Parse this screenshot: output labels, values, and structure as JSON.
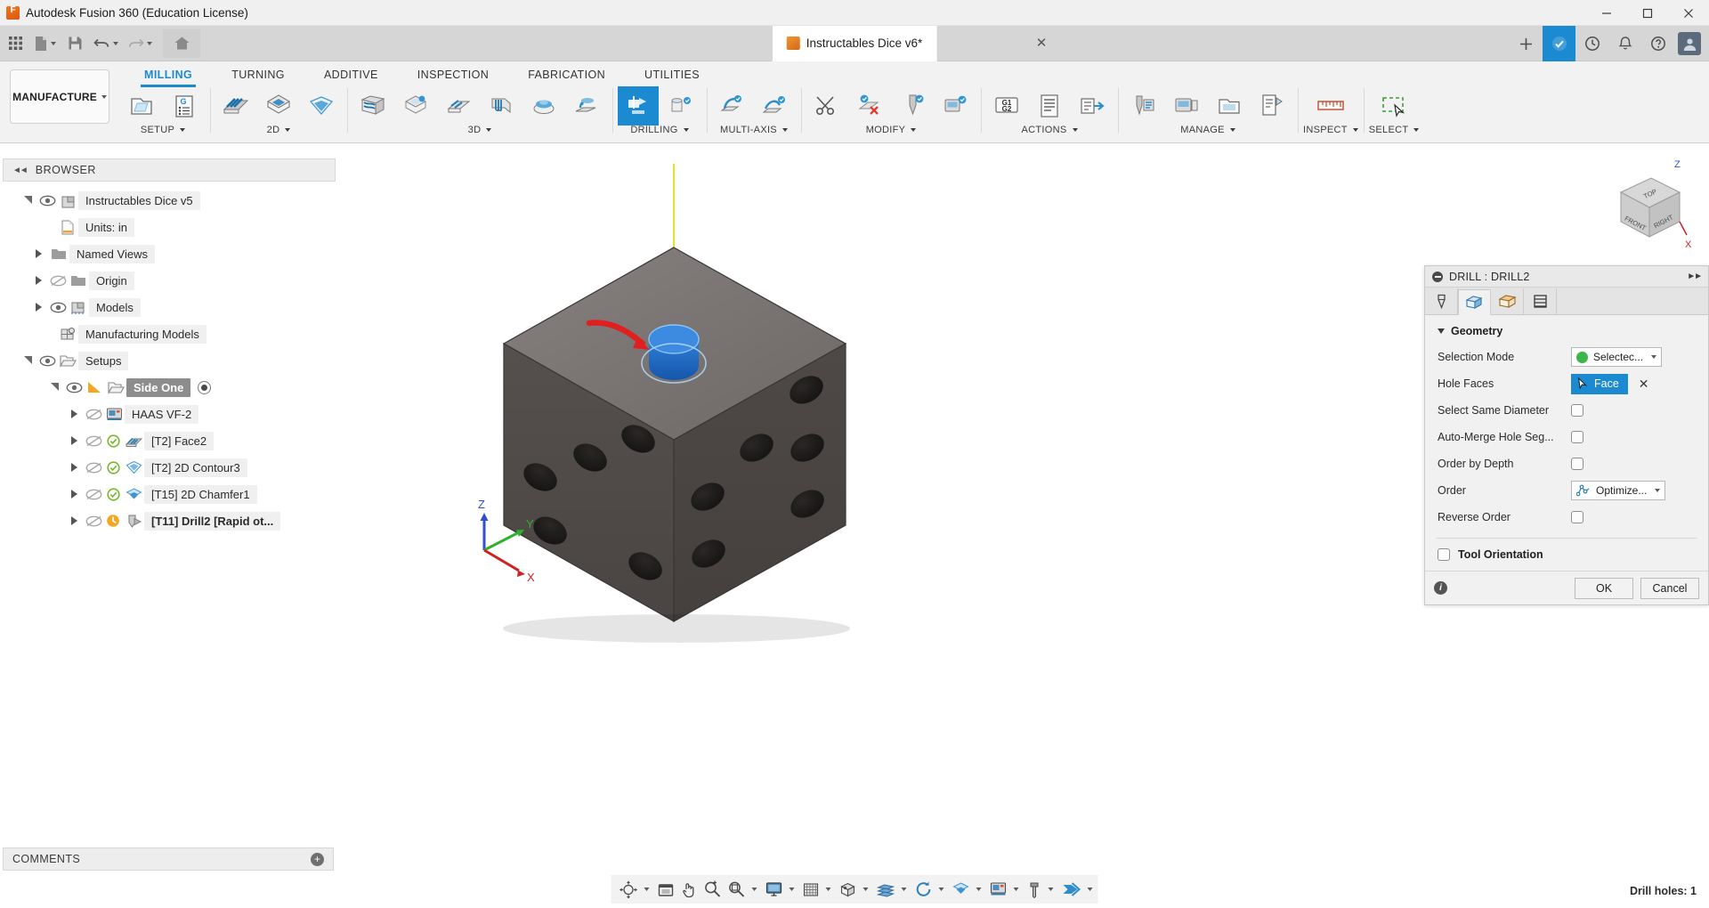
{
  "window": {
    "title": "Autodesk Fusion 360 (Education License)",
    "logo_icon": "fusion-360-logo",
    "minimize_icon": "minimize-icon",
    "maximize_icon": "maximize-icon",
    "close_icon": "close-icon"
  },
  "quick_access": {
    "grid_icon": "app-grid-icon",
    "new_icon": "new-document-icon",
    "save_icon": "save-icon",
    "undo_icon": "undo-icon",
    "redo_icon": "redo-icon",
    "home_icon": "home-icon",
    "document_tab": {
      "name": "Instructables Dice v6*",
      "file_icon": "orange-cube-icon",
      "close_icon": "close-tab-icon"
    },
    "add_tab_icon": "plus-icon",
    "extension_icon": "extension-icon",
    "history_icon": "job-status-icon",
    "notifications_icon": "bell-icon",
    "help_icon": "help-icon",
    "avatar_icon": "user-avatar"
  },
  "ribbon": {
    "workspace": {
      "label": "MANUFACTURE",
      "caret": "chevron-down-icon"
    },
    "tabs": [
      {
        "label": "MILLING",
        "active": true
      },
      {
        "label": "TURNING",
        "active": false
      },
      {
        "label": "ADDITIVE",
        "active": false
      },
      {
        "label": "INSPECTION",
        "active": false
      },
      {
        "label": "FABRICATION",
        "active": false
      },
      {
        "label": "UTILITIES",
        "active": false
      }
    ],
    "panels": [
      {
        "label": "SETUP",
        "has_caret": true,
        "buttons": [
          {
            "icon": "setup-new-icon",
            "selected": false
          },
          {
            "icon": "generate-nc-program-icon",
            "selected": false
          }
        ]
      },
      {
        "label": "2D",
        "has_caret": true,
        "buttons": [
          {
            "icon": "face-2d-icon",
            "selected": false
          },
          {
            "icon": "pocket-2d-icon",
            "selected": false
          },
          {
            "icon": "contour-2d-icon",
            "selected": false
          }
        ]
      },
      {
        "label": "3D",
        "has_caret": true,
        "buttons": [
          {
            "icon": "adaptive-clearing-icon",
            "selected": false
          },
          {
            "icon": "pocket-clearing-icon",
            "selected": false
          },
          {
            "icon": "parallel-3d-icon",
            "selected": false
          },
          {
            "icon": "scallop-3d-icon",
            "selected": false
          },
          {
            "icon": "radial-3d-icon",
            "selected": false
          },
          {
            "icon": "spiral-3d-icon",
            "selected": false
          }
        ]
      },
      {
        "label": "DRILLING",
        "has_caret": true,
        "buttons": [
          {
            "icon": "drill-icon",
            "selected": true
          },
          {
            "icon": "bore-icon",
            "selected": false
          }
        ]
      },
      {
        "label": "MULTI-AXIS",
        "has_caret": true,
        "buttons": [
          {
            "icon": "swarf-icon",
            "selected": false
          },
          {
            "icon": "multi-axis-contour-icon",
            "selected": false
          }
        ]
      },
      {
        "label": "MODIFY",
        "has_caret": true,
        "buttons": [
          {
            "icon": "trim-icon",
            "selected": false
          },
          {
            "icon": "delete-toolpath-icon",
            "selected": false
          },
          {
            "icon": "tool-library-icon",
            "selected": false
          },
          {
            "icon": "machine-library-icon",
            "selected": false
          }
        ]
      },
      {
        "label": "ACTIONS",
        "has_caret": true,
        "buttons": [
          {
            "icon": "g1-g2-icon",
            "selected": false
          },
          {
            "icon": "setup-sheet-icon",
            "selected": false
          },
          {
            "icon": "post-process-icon",
            "selected": false
          }
        ]
      },
      {
        "label": "MANAGE",
        "has_caret": true,
        "buttons": [
          {
            "icon": "tool-library-manage-icon",
            "selected": false
          },
          {
            "icon": "machine-library-manage-icon",
            "selected": false
          },
          {
            "icon": "template-library-icon",
            "selected": false
          },
          {
            "icon": "print-setup-icon",
            "selected": false
          }
        ]
      },
      {
        "label": "INSPECT",
        "has_caret": true,
        "buttons": [
          {
            "icon": "measure-icon",
            "selected": false
          }
        ]
      },
      {
        "label": "SELECT",
        "has_caret": true,
        "buttons": [
          {
            "icon": "select-window-icon",
            "selected": false
          }
        ]
      }
    ]
  },
  "browser": {
    "header": "BROWSER",
    "collapse_icon": "collapse-left-icon",
    "tree": [
      {
        "label": "Instructables Dice v5",
        "indent": 0,
        "expander": "down",
        "eye": "visible",
        "icon": "document-body-icon",
        "selected": false
      },
      {
        "label": "Units: in",
        "indent": 1,
        "expander": "none",
        "eye": "none",
        "icon": "units-icon",
        "selected": false
      },
      {
        "label": "Named Views",
        "indent": 1,
        "expander": "right",
        "eye": "none",
        "icon": "folder-icon",
        "selected": false
      },
      {
        "label": "Origin",
        "indent": 1,
        "expander": "right",
        "eye": "hidden",
        "icon": "folder-icon",
        "selected": false
      },
      {
        "label": "Models",
        "indent": 1,
        "expander": "right",
        "eye": "visible",
        "icon": "models-icon",
        "selected": false
      },
      {
        "label": "Manufacturing Models",
        "indent": 1,
        "expander": "none",
        "eye": "none",
        "icon": "manufacturing-models-icon",
        "selected": false
      },
      {
        "label": "Setups",
        "indent": 1,
        "expander": "down",
        "eye": "visible",
        "icon": "setups-folder-icon",
        "selected": false
      },
      {
        "label": "Side One",
        "indent": 2,
        "expander": "down",
        "eye": "visible",
        "icon": "setup-folder-icon",
        "selected": true,
        "extra_icon": "wcs-triangle-icon",
        "radio": true
      },
      {
        "label": "HAAS VF-2",
        "indent": 3,
        "expander": "right",
        "eye": "hidden",
        "icon": "machine-icon",
        "selected": false
      },
      {
        "label": "[T2] Face2",
        "indent": 3,
        "expander": "right",
        "eye": "hidden",
        "icon": "face-operation-icon",
        "status": "ok",
        "selected": false
      },
      {
        "label": "[T2] 2D Contour3",
        "indent": 3,
        "expander": "right",
        "eye": "hidden",
        "icon": "contour-operation-icon",
        "status": "ok",
        "selected": false
      },
      {
        "label": "[T15] 2D Chamfer1",
        "indent": 3,
        "expander": "right",
        "eye": "hidden",
        "icon": "chamfer-operation-icon",
        "status": "ok",
        "selected": false
      },
      {
        "label": "[T11] Drill2 [Rapid ot...",
        "indent": 3,
        "expander": "right",
        "eye": "hidden",
        "icon": "drill-operation-icon",
        "status": "warn",
        "bold": true,
        "selected": false
      }
    ]
  },
  "canvas": {
    "view_cube": {
      "top_label": "TOP",
      "front_label": "FRONT",
      "right_label": "RIGHT",
      "axis_z": "Z",
      "axis_x": "X"
    },
    "origin_triad": {
      "x": "X",
      "y": "Y",
      "z": "Z"
    },
    "annotation_arrow": "red-arrow-pointer",
    "selected_face_color": "#1b6fd4",
    "model_color": "#6f6a67"
  },
  "dialog": {
    "title": "DRILL : DRILL2",
    "minimize_icon": "collapse-circle-icon",
    "expand_icon": "expand-right-icon",
    "tabs": [
      {
        "icon": "tool-tab-icon",
        "active": false
      },
      {
        "icon": "geometry-tab-icon",
        "active": true
      },
      {
        "icon": "heights-tab-icon",
        "active": false
      },
      {
        "icon": "passes-tab-icon",
        "active": false
      }
    ],
    "section": {
      "title": "Geometry",
      "expanded": true
    },
    "fields": [
      {
        "name": "Selection Mode",
        "type": "combo",
        "value": "Selectec...",
        "swatch": "#3cb54a",
        "icon": "green-circle-icon"
      },
      {
        "name": "Hole Faces",
        "type": "select-button",
        "value": "Face",
        "icon": "cursor-arrow-icon",
        "clear_icon": "clear-selection-icon"
      },
      {
        "name": "Select Same Diameter",
        "type": "checkbox",
        "checked": false
      },
      {
        "name": "Auto-Merge Hole Seɡ...",
        "type": "checkbox",
        "checked": false
      },
      {
        "name": "Order by Depth",
        "type": "checkbox",
        "checked": false
      },
      {
        "name": "Order",
        "type": "combo",
        "value": "Optimize...",
        "icon": "order-path-icon"
      },
      {
        "name": "Reverse Order",
        "type": "checkbox",
        "checked": false
      }
    ],
    "tool_orientation": {
      "label": "Tool Orientation",
      "checked": false
    },
    "info_icon": "info-icon",
    "ok_label": "OK",
    "cancel_label": "Cancel",
    "accent_color": "#1b8ad1"
  },
  "comments": {
    "label": "COMMENTS",
    "add_icon": "add-comment-icon"
  },
  "nav_toolbar": [
    {
      "icon": "orbit-icon",
      "caret": true
    },
    {
      "icon": "display-settings-icon",
      "caret": false
    },
    {
      "icon": "pan-icon",
      "caret": false
    },
    {
      "icon": "zoom-in-icon",
      "caret": false
    },
    {
      "icon": "zoom-window-icon",
      "caret": true
    },
    {
      "icon": "display-mode-icon",
      "caret": true
    },
    {
      "icon": "grid-snap-icon",
      "caret": true
    },
    {
      "icon": "viewports-icon",
      "caret": true
    },
    {
      "icon": "stock-visibility-icon",
      "caret": true
    },
    {
      "icon": "simulate-icon",
      "caret": true
    },
    {
      "icon": "toolpath-visibility-icon",
      "caret": true
    },
    {
      "icon": "machine-view-icon",
      "caret": true
    },
    {
      "icon": "tool-visibility-icon",
      "caret": true
    },
    {
      "icon": "probe-icon",
      "caret": true
    }
  ],
  "status_bar": {
    "right_text": "Drill holes: 1"
  }
}
